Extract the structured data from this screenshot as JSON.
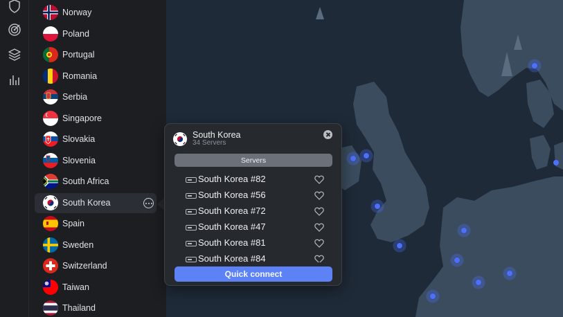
{
  "rail": {
    "icons": [
      "shield-icon",
      "target-icon",
      "layers-icon",
      "stats-icon"
    ]
  },
  "countries": [
    {
      "name": "Norway"
    },
    {
      "name": "Poland"
    },
    {
      "name": "Portugal"
    },
    {
      "name": "Romania"
    },
    {
      "name": "Serbia"
    },
    {
      "name": "Singapore"
    },
    {
      "name": "Slovakia"
    },
    {
      "name": "Slovenia"
    },
    {
      "name": "South Africa"
    },
    {
      "name": "South Korea",
      "selected": true
    },
    {
      "name": "Spain"
    },
    {
      "name": "Sweden"
    },
    {
      "name": "Switzerland"
    },
    {
      "name": "Taiwan"
    },
    {
      "name": "Thailand"
    }
  ],
  "popup": {
    "country": "South Korea",
    "server_count": "34 Servers",
    "tab_label": "Servers",
    "servers": [
      {
        "name": "South Korea #82"
      },
      {
        "name": "South Korea #56"
      },
      {
        "name": "South Korea #72"
      },
      {
        "name": "South Korea #47"
      },
      {
        "name": "South Korea #81"
      },
      {
        "name": "South Korea #84"
      }
    ],
    "connect_label": "Quick connect"
  },
  "colors": {
    "accent": "#5c82f5",
    "map_land": "#3a4c5e",
    "map_water": "#1f2a38",
    "server_dot": "#4d6fff",
    "sidebar_bg": "#1c1e22"
  }
}
